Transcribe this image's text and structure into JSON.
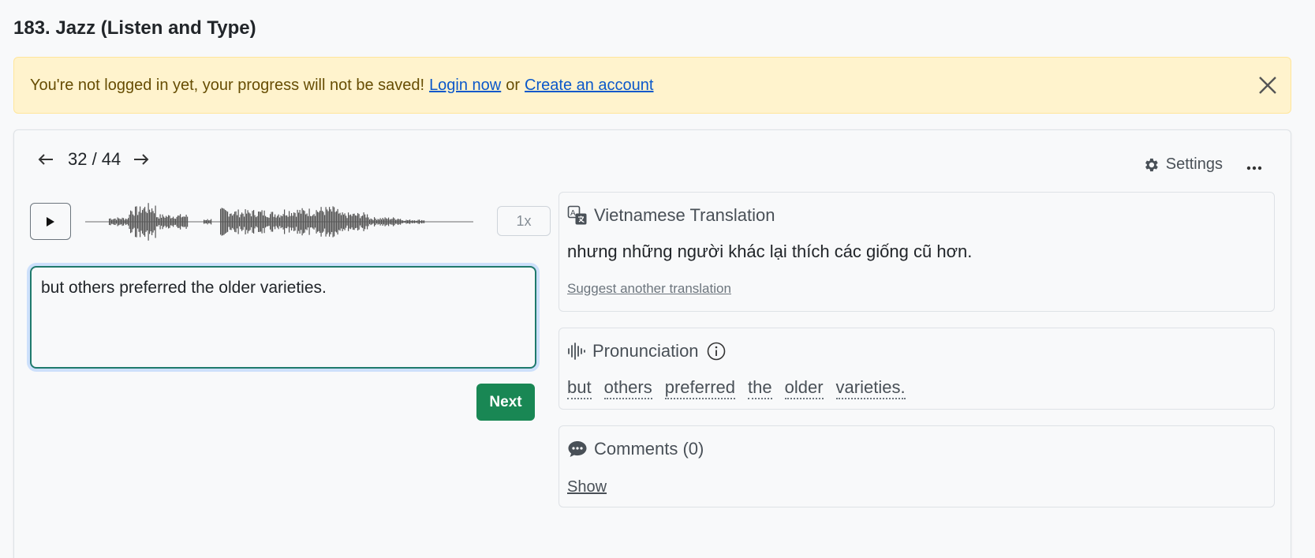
{
  "page": {
    "title": "183. Jazz (Listen and Type)"
  },
  "alert": {
    "message": "You're not logged in yet, your progress will not be saved!",
    "login_link": "Login now",
    "separator": "or",
    "signup_link": "Create an account",
    "close_icon": "close-icon"
  },
  "nav": {
    "prev_icon": "arrow-left-icon",
    "counter": "32 / 44",
    "next_icon": "arrow-right-icon"
  },
  "settings": {
    "label": "Settings",
    "icon": "gear-icon",
    "more_icon": "more-icon"
  },
  "player": {
    "play_icon": "play-icon",
    "speed": "1x"
  },
  "answer": {
    "value": "but others preferred the older varieties."
  },
  "next_button": {
    "label": "Next",
    "color": "#198754"
  },
  "translation": {
    "title": "Vietnamese Translation",
    "text": "nhưng những người khác lại thích các giống cũ hơn.",
    "suggest_link": "Suggest another translation",
    "icon": "translate-icon"
  },
  "pronunciation": {
    "title": "Pronunciation",
    "icon": "waveform-icon",
    "info_icon": "info-icon",
    "words": [
      "but",
      "others",
      "preferred",
      "the",
      "older",
      "varieties."
    ]
  },
  "comments": {
    "title": "Comments (0)",
    "show_link": "Show",
    "icon": "comment-icon"
  }
}
